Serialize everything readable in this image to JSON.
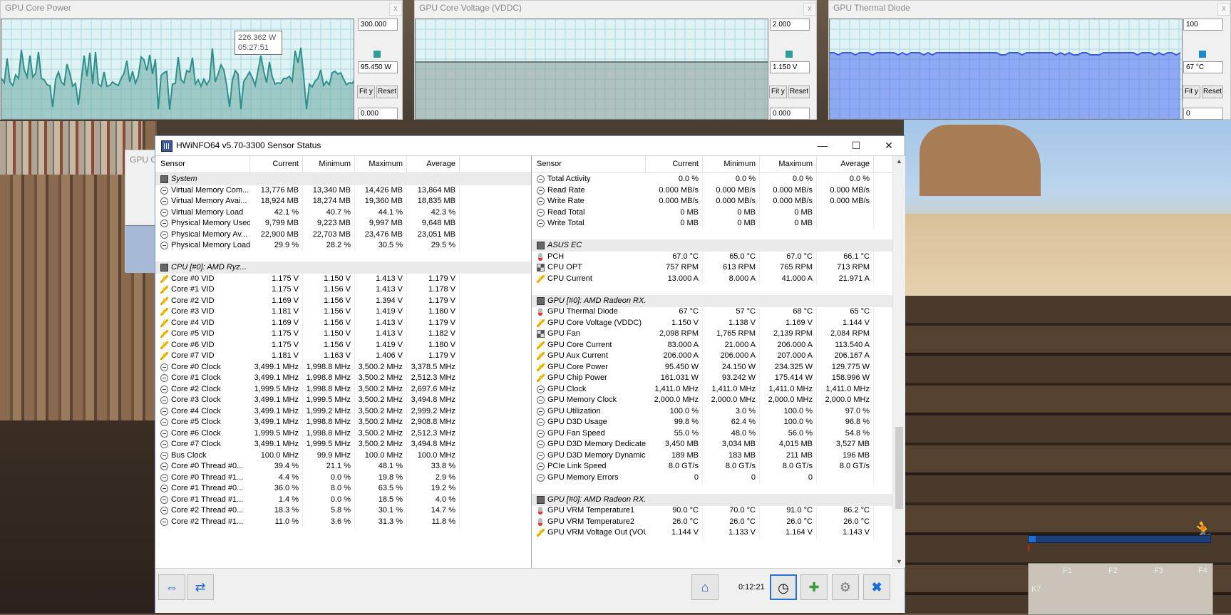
{
  "graph_windows": [
    {
      "title": "GPU Core Power",
      "max_value": "300.000",
      "current_value": "95.450 W",
      "min_value": "0.000",
      "fit_label": "Fit y",
      "reset_label": "Reset",
      "close_glyph": "x",
      "color": "#2f9e9a",
      "tooltip": {
        "value": "226.362 W",
        "time": "05:27:51"
      }
    },
    {
      "title": "GPU Core Voltage (VDDC)",
      "max_value": "2.000",
      "current_value": "1.150 V",
      "min_value": "0.000",
      "fit_label": "Fit y",
      "reset_label": "Reset",
      "close_glyph": "x",
      "color": "#2f9e9a"
    },
    {
      "title": "GPU Thermal Diode",
      "max_value": "100",
      "current_value": "67 °C",
      "min_value": "0",
      "fit_label": "Fit y",
      "reset_label": "Reset",
      "close_glyph": "x",
      "color": "#1e88c8"
    }
  ],
  "ghost_window_title": "GPU C",
  "main_window": {
    "title": "HWiNFO64 v5.70-3300 Sensor Status",
    "controls": {
      "minimize": "—",
      "maximize": "☐",
      "close": "✕"
    },
    "columns": [
      "Sensor",
      "Current",
      "Minimum",
      "Maximum",
      "Average"
    ],
    "left_rows": [
      {
        "type": "group",
        "icon": "chip",
        "label": "System"
      },
      {
        "icon": "clock",
        "label": "Virtual Memory Com...",
        "cur": "13,776 MB",
        "min": "13,340 MB",
        "max": "14,426 MB",
        "avg": "13,864 MB"
      },
      {
        "icon": "clock",
        "label": "Virtual Memory Avai...",
        "cur": "18,924 MB",
        "min": "18,274 MB",
        "max": "19,360 MB",
        "avg": "18,835 MB"
      },
      {
        "icon": "clock",
        "label": "Virtual Memory Load",
        "cur": "42.1 %",
        "min": "40.7 %",
        "max": "44.1 %",
        "avg": "42.3 %"
      },
      {
        "icon": "clock",
        "label": "Physical Memory Used",
        "cur": "9,799 MB",
        "min": "9,223 MB",
        "max": "9,997 MB",
        "avg": "9,648 MB"
      },
      {
        "icon": "clock",
        "label": "Physical Memory Av...",
        "cur": "22,900 MB",
        "min": "22,703 MB",
        "max": "23,476 MB",
        "avg": "23,051 MB"
      },
      {
        "icon": "clock",
        "label": "Physical Memory Load",
        "cur": "29.9 %",
        "min": "28.2 %",
        "max": "30.5 %",
        "avg": "29.5 %"
      },
      {
        "type": "blank"
      },
      {
        "type": "group",
        "icon": "chip",
        "label": "CPU [#0]: AMD Ryz..."
      },
      {
        "icon": "volt",
        "label": "Core #0 VID",
        "cur": "1.175 V",
        "min": "1.150 V",
        "max": "1.413 V",
        "avg": "1.179 V"
      },
      {
        "icon": "volt",
        "label": "Core #1 VID",
        "cur": "1.175 V",
        "min": "1.156 V",
        "max": "1.413 V",
        "avg": "1.178 V"
      },
      {
        "icon": "volt",
        "label": "Core #2 VID",
        "cur": "1.169 V",
        "min": "1.156 V",
        "max": "1.394 V",
        "avg": "1.179 V"
      },
      {
        "icon": "volt",
        "label": "Core #3 VID",
        "cur": "1.181 V",
        "min": "1.156 V",
        "max": "1.419 V",
        "avg": "1.180 V"
      },
      {
        "icon": "volt",
        "label": "Core #4 VID",
        "cur": "1.169 V",
        "min": "1.156 V",
        "max": "1.413 V",
        "avg": "1.179 V"
      },
      {
        "icon": "volt",
        "label": "Core #5 VID",
        "cur": "1.175 V",
        "min": "1.150 V",
        "max": "1.413 V",
        "avg": "1.182 V"
      },
      {
        "icon": "volt",
        "label": "Core #6 VID",
        "cur": "1.175 V",
        "min": "1.156 V",
        "max": "1.419 V",
        "avg": "1.180 V"
      },
      {
        "icon": "volt",
        "label": "Core #7 VID",
        "cur": "1.181 V",
        "min": "1.163 V",
        "max": "1.406 V",
        "avg": "1.179 V"
      },
      {
        "icon": "clock",
        "label": "Core #0 Clock",
        "cur": "3,499.1 MHz",
        "min": "1,998.8 MHz",
        "max": "3,500.2 MHz",
        "avg": "3,378.5 MHz"
      },
      {
        "icon": "clock",
        "label": "Core #1 Clock",
        "cur": "3,499.1 MHz",
        "min": "1,998.8 MHz",
        "max": "3,500.2 MHz",
        "avg": "2,512.3 MHz"
      },
      {
        "icon": "clock",
        "label": "Core #2 Clock",
        "cur": "1,999.5 MHz",
        "min": "1,998.8 MHz",
        "max": "3,500.2 MHz",
        "avg": "2,697.6 MHz"
      },
      {
        "icon": "clock",
        "label": "Core #3 Clock",
        "cur": "3,499.1 MHz",
        "min": "1,999.5 MHz",
        "max": "3,500.2 MHz",
        "avg": "3,494.8 MHz"
      },
      {
        "icon": "clock",
        "label": "Core #4 Clock",
        "cur": "3,499.1 MHz",
        "min": "1,999.2 MHz",
        "max": "3,500.2 MHz",
        "avg": "2,999.2 MHz"
      },
      {
        "icon": "clock",
        "label": "Core #5 Clock",
        "cur": "3,499.1 MHz",
        "min": "1,998.8 MHz",
        "max": "3,500.2 MHz",
        "avg": "2,908.8 MHz"
      },
      {
        "icon": "clock",
        "label": "Core #6 Clock",
        "cur": "1,999.5 MHz",
        "min": "1,998.8 MHz",
        "max": "3,500.2 MHz",
        "avg": "2,512.3 MHz"
      },
      {
        "icon": "clock",
        "label": "Core #7 Clock",
        "cur": "3,499.1 MHz",
        "min": "1,999.5 MHz",
        "max": "3,500.2 MHz",
        "avg": "3,494.8 MHz"
      },
      {
        "icon": "clock",
        "label": "Bus Clock",
        "cur": "100.0 MHz",
        "min": "99.9 MHz",
        "max": "100.0 MHz",
        "avg": "100.0 MHz"
      },
      {
        "icon": "clock",
        "label": "Core #0 Thread #0...",
        "cur": "39.4 %",
        "min": "21.1 %",
        "max": "48.1 %",
        "avg": "33.8 %"
      },
      {
        "icon": "clock",
        "label": "Core #0 Thread #1...",
        "cur": "4.4 %",
        "min": "0.0 %",
        "max": "19.8 %",
        "avg": "2.9 %"
      },
      {
        "icon": "clock",
        "label": "Core #1 Thread #0...",
        "cur": "36.0 %",
        "min": "8.0 %",
        "max": "63.5 %",
        "avg": "19.2 %"
      },
      {
        "icon": "clock",
        "label": "Core #1 Thread #1...",
        "cur": "1.4 %",
        "min": "0.0 %",
        "max": "18.5 %",
        "avg": "4.0 %"
      },
      {
        "icon": "clock",
        "label": "Core #2 Thread #0...",
        "cur": "18.3 %",
        "min": "5.8 %",
        "max": "30.1 %",
        "avg": "14.7 %"
      },
      {
        "icon": "clock",
        "label": "Core #2 Thread #1...",
        "cur": "11.0 %",
        "min": "3.6 %",
        "max": "31.3 %",
        "avg": "11.8 %"
      }
    ],
    "right_rows": [
      {
        "icon": "clock",
        "label": "Total Activity",
        "cur": "0.0 %",
        "min": "0.0 %",
        "max": "0.0 %",
        "avg": "0.0 %"
      },
      {
        "icon": "clock",
        "label": "Read Rate",
        "cur": "0.000 MB/s",
        "min": "0.000 MB/s",
        "max": "0.000 MB/s",
        "avg": "0.000 MB/s"
      },
      {
        "icon": "clock",
        "label": "Write Rate",
        "cur": "0.000 MB/s",
        "min": "0.000 MB/s",
        "max": "0.000 MB/s",
        "avg": "0.000 MB/s"
      },
      {
        "icon": "clock",
        "label": "Read Total",
        "cur": "0 MB",
        "min": "0 MB",
        "max": "0 MB",
        "avg": ""
      },
      {
        "icon": "clock",
        "label": "Write Total",
        "cur": "0 MB",
        "min": "0 MB",
        "max": "0 MB",
        "avg": ""
      },
      {
        "type": "blank"
      },
      {
        "type": "group",
        "icon": "chip",
        "label": "ASUS EC"
      },
      {
        "icon": "temp",
        "label": "PCH",
        "cur": "67.0 °C",
        "min": "65.0 °C",
        "max": "67.0 °C",
        "avg": "66.1 °C"
      },
      {
        "icon": "fan",
        "label": "CPU OPT",
        "cur": "757 RPM",
        "min": "613 RPM",
        "max": "765 RPM",
        "avg": "713 RPM"
      },
      {
        "icon": "volt",
        "label": "CPU Current",
        "cur": "13.000 A",
        "min": "8.000 A",
        "max": "41.000 A",
        "avg": "21.971 A"
      },
      {
        "type": "blank"
      },
      {
        "type": "group",
        "icon": "chip",
        "label": "GPU [#0]: AMD Radeon RX..."
      },
      {
        "icon": "temp",
        "label": "GPU Thermal Diode",
        "cur": "67 °C",
        "min": "57 °C",
        "max": "68 °C",
        "avg": "65 °C"
      },
      {
        "icon": "volt",
        "label": "GPU Core Voltage (VDDC)",
        "cur": "1.150 V",
        "min": "1.138 V",
        "max": "1.169 V",
        "avg": "1.144 V"
      },
      {
        "icon": "fan",
        "label": "GPU Fan",
        "cur": "2,098 RPM",
        "min": "1,765 RPM",
        "max": "2,139 RPM",
        "avg": "2,084 RPM"
      },
      {
        "icon": "volt",
        "label": "GPU Core Current",
        "cur": "83.000 A",
        "min": "21.000 A",
        "max": "206.000 A",
        "avg": "113.540 A"
      },
      {
        "icon": "volt",
        "label": "GPU Aux Current",
        "cur": "206.000 A",
        "min": "206.000 A",
        "max": "207.000 A",
        "avg": "206.167 A"
      },
      {
        "icon": "volt",
        "label": "GPU Core Power",
        "cur": "95.450 W",
        "min": "24.150 W",
        "max": "234.325 W",
        "avg": "129.775 W"
      },
      {
        "icon": "volt",
        "label": "GPU Chip Power",
        "cur": "161.031 W",
        "min": "93.242 W",
        "max": "175.414 W",
        "avg": "158.996 W"
      },
      {
        "icon": "clock",
        "label": "GPU Clock",
        "cur": "1,411.0 MHz",
        "min": "1,411.0 MHz",
        "max": "1,411.0 MHz",
        "avg": "1,411.0 MHz"
      },
      {
        "icon": "clock",
        "label": "GPU Memory Clock",
        "cur": "2,000.0 MHz",
        "min": "2,000.0 MHz",
        "max": "2,000.0 MHz",
        "avg": "2,000.0 MHz"
      },
      {
        "icon": "clock",
        "label": "GPU Utilization",
        "cur": "100.0 %",
        "min": "3.0 %",
        "max": "100.0 %",
        "avg": "97.0 %"
      },
      {
        "icon": "clock",
        "label": "GPU D3D Usage",
        "cur": "99.8 %",
        "min": "62.4 %",
        "max": "100.0 %",
        "avg": "96.8 %"
      },
      {
        "icon": "clock",
        "label": "GPU Fan Speed",
        "cur": "55.0 %",
        "min": "48.0 %",
        "max": "56.0 %",
        "avg": "54.8 %"
      },
      {
        "icon": "clock",
        "label": "GPU D3D Memory Dedicated",
        "cur": "3,450 MB",
        "min": "3,034 MB",
        "max": "4,015 MB",
        "avg": "3,527 MB"
      },
      {
        "icon": "clock",
        "label": "GPU D3D Memory Dynamic",
        "cur": "189 MB",
        "min": "183 MB",
        "max": "211 MB",
        "avg": "196 MB"
      },
      {
        "icon": "clock",
        "label": "PCIe Link Speed",
        "cur": "8.0 GT/s",
        "min": "8.0 GT/s",
        "max": "8.0 GT/s",
        "avg": "8.0 GT/s"
      },
      {
        "icon": "clock",
        "label": "GPU Memory Errors",
        "cur": "0",
        "min": "0",
        "max": "0",
        "avg": ""
      },
      {
        "type": "blank"
      },
      {
        "type": "group",
        "icon": "chip",
        "label": "GPU [#0]: AMD Radeon RX..."
      },
      {
        "icon": "temp",
        "label": "GPU VRM Temperature1",
        "cur": "90.0 °C",
        "min": "70.0 °C",
        "max": "91.0 °C",
        "avg": "86.2 °C"
      },
      {
        "icon": "temp",
        "label": "GPU VRM Temperature2",
        "cur": "26.0 °C",
        "min": "26.0 °C",
        "max": "26.0 °C",
        "avg": "26.0 °C"
      },
      {
        "icon": "volt",
        "label": "GPU VRM Voltage Out (VOU...",
        "cur": "1.144 V",
        "min": "1.133 V",
        "max": "1.164 V",
        "avg": "1.143 V"
      }
    ],
    "footer": {
      "elapsed": "0:12:21",
      "buttons": [
        "nav-arrows-icon",
        "collapse-arrows-icon",
        "network-icon",
        "clock-icon",
        "add-report-icon",
        "settings-icon",
        "close-x-icon"
      ]
    }
  },
  "hud": {
    "minimap_labels": [
      "F1",
      "F2",
      "F3",
      "F4",
      "K7"
    ],
    "warning": "!"
  }
}
